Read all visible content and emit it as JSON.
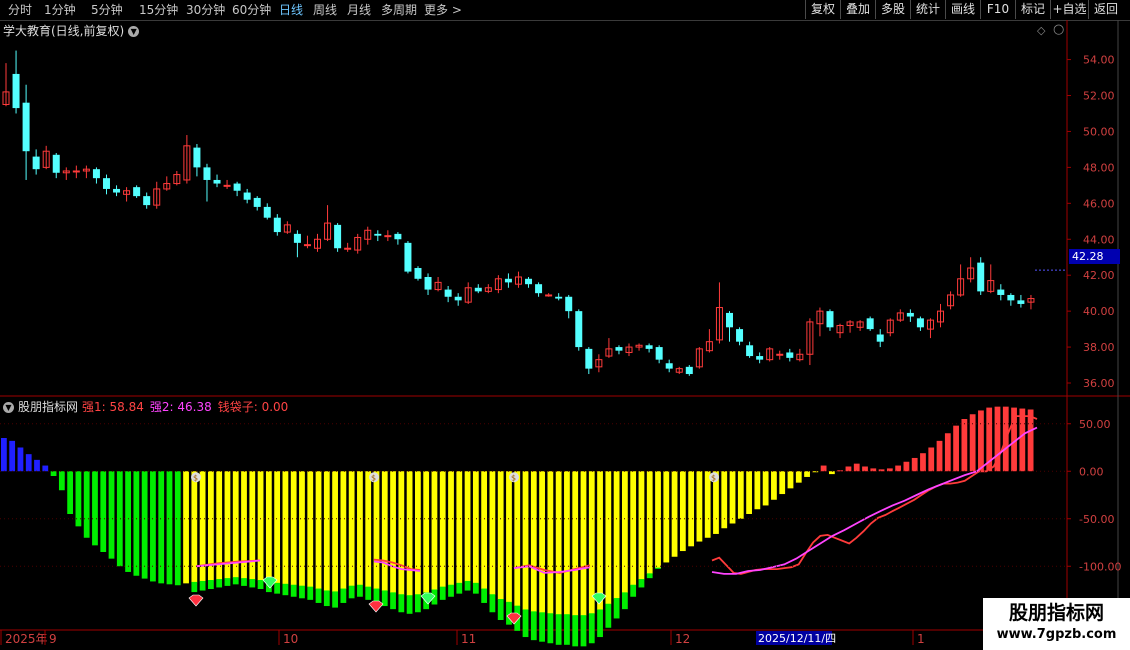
{
  "toolbar": {
    "periods": [
      "分时",
      "1分钟",
      "5分钟",
      "15分钟",
      "30分钟",
      "60分钟",
      "日线",
      "周线",
      "月线",
      "多周期",
      "更多 >"
    ],
    "right_buttons": [
      "复权",
      "叠加",
      "多股",
      "统计",
      "画线",
      "F10",
      "标记",
      "+自选",
      "返回"
    ]
  },
  "main": {
    "title": "学大教育(日线,前复权)",
    "price_label": "42.28",
    "y_ticks": [
      "54.00",
      "52.00",
      "50.00",
      "48.00",
      "46.00",
      "44.00",
      "42.00",
      "40.00",
      "38.00",
      "36.00"
    ]
  },
  "indicator": {
    "name": "股朋指标网",
    "s1": "强1: 58.84",
    "s2": "强2: 46.38",
    "s3": "钱袋子: 0.00",
    "y_ticks": [
      "50.00",
      "0.00",
      "-50.00",
      "-100.00"
    ]
  },
  "xaxis": {
    "labels": [
      "2025年",
      "9",
      "10",
      "11",
      "12",
      "1"
    ],
    "date_tag": "2025/12/11/四"
  },
  "watermark": {
    "line1": "股朋指标网",
    "line2": "www.7gpzb.com"
  },
  "colors": {
    "up": "#ff3b3b",
    "down": "#54ffff",
    "axis": "#a00000",
    "yellow": "#ffff00",
    "green": "#00ee00",
    "blue": "#2020ff",
    "magenta": "#ff44ff"
  },
  "chart_data": {
    "type": "candlestick",
    "ylim": [
      35.5,
      55.2
    ],
    "candles": [
      [
        51.5,
        52.2,
        53.8,
        51.4
      ],
      [
        53.2,
        51.3,
        54.5,
        51.0
      ],
      [
        51.6,
        48.9,
        52.6,
        47.3
      ],
      [
        48.6,
        47.9,
        49.0,
        47.6
      ],
      [
        48.0,
        48.9,
        49.2,
        47.9
      ],
      [
        48.7,
        47.7,
        48.8,
        47.4
      ],
      [
        47.7,
        47.8,
        48.0,
        47.3
      ],
      [
        47.8,
        47.8,
        48.1,
        47.4
      ],
      [
        47.8,
        47.9,
        48.1,
        47.4
      ],
      [
        47.9,
        47.4,
        48.0,
        47.1
      ],
      [
        47.4,
        46.8,
        47.6,
        46.5
      ],
      [
        46.8,
        46.6,
        47.0,
        46.4
      ],
      [
        46.5,
        46.7,
        46.9,
        46.1
      ],
      [
        46.9,
        46.4,
        47.0,
        46.3
      ],
      [
        46.4,
        45.9,
        46.6,
        45.7
      ],
      [
        45.9,
        46.8,
        47.2,
        45.7
      ],
      [
        46.8,
        47.1,
        47.5,
        46.7
      ],
      [
        47.1,
        47.6,
        47.8,
        47.0
      ],
      [
        47.3,
        49.2,
        49.8,
        47.1
      ],
      [
        49.1,
        48.0,
        49.3,
        47.5
      ],
      [
        48.0,
        47.3,
        48.2,
        46.1
      ],
      [
        47.3,
        47.1,
        47.6,
        46.9
      ],
      [
        47.0,
        47.0,
        47.3,
        46.8
      ],
      [
        47.1,
        46.7,
        47.2,
        46.4
      ],
      [
        46.6,
        46.2,
        46.8,
        46.0
      ],
      [
        46.3,
        45.8,
        46.4,
        45.6
      ],
      [
        45.8,
        45.2,
        46.0,
        45.1
      ],
      [
        45.2,
        44.4,
        45.4,
        44.2
      ],
      [
        44.4,
        44.8,
        45.0,
        44.3
      ],
      [
        44.3,
        43.8,
        44.5,
        43.0
      ],
      [
        43.7,
        43.7,
        44.2,
        43.5
      ],
      [
        43.5,
        44.0,
        44.3,
        43.3
      ],
      [
        44.0,
        44.9,
        45.9,
        43.9
      ],
      [
        44.8,
        43.5,
        44.9,
        43.3
      ],
      [
        43.5,
        43.5,
        43.8,
        43.3
      ],
      [
        43.4,
        44.1,
        44.3,
        43.2
      ],
      [
        44.0,
        44.5,
        44.7,
        43.7
      ],
      [
        44.3,
        44.2,
        44.5,
        43.9
      ],
      [
        44.2,
        44.2,
        44.5,
        43.9
      ],
      [
        44.3,
        44.0,
        44.4,
        43.7
      ],
      [
        43.8,
        42.2,
        43.9,
        42.1
      ],
      [
        42.4,
        41.8,
        42.5,
        41.7
      ],
      [
        41.9,
        41.2,
        42.1,
        40.9
      ],
      [
        41.2,
        41.6,
        41.9,
        41.1
      ],
      [
        41.2,
        40.8,
        41.4,
        40.5
      ],
      [
        40.8,
        40.6,
        41.0,
        40.3
      ],
      [
        40.5,
        41.3,
        41.6,
        40.4
      ],
      [
        41.3,
        41.1,
        41.5,
        41.0
      ],
      [
        41.1,
        41.3,
        41.5,
        41.0
      ],
      [
        41.2,
        41.8,
        42.0,
        41.0
      ],
      [
        41.8,
        41.6,
        42.1,
        41.3
      ],
      [
        41.5,
        41.9,
        42.2,
        41.3
      ],
      [
        41.8,
        41.5,
        41.9,
        41.3
      ],
      [
        41.5,
        41.0,
        41.6,
        40.8
      ],
      [
        40.9,
        40.9,
        41.0,
        40.8
      ],
      [
        40.8,
        40.7,
        41.0,
        40.6
      ],
      [
        40.8,
        40.0,
        40.9,
        39.6
      ],
      [
        40.0,
        38.0,
        40.1,
        37.8
      ],
      [
        37.9,
        36.8,
        38.0,
        36.5
      ],
      [
        36.9,
        37.3,
        37.6,
        36.6
      ],
      [
        37.5,
        37.9,
        38.5,
        37.4
      ],
      [
        38.0,
        37.8,
        38.1,
        37.6
      ],
      [
        37.7,
        38.0,
        38.2,
        37.5
      ],
      [
        38.0,
        38.1,
        38.2,
        37.8
      ],
      [
        38.1,
        37.9,
        38.2,
        37.7
      ],
      [
        38.0,
        37.3,
        38.1,
        37.1
      ],
      [
        37.1,
        36.8,
        37.3,
        36.6
      ],
      [
        36.6,
        36.8,
        36.9,
        36.5
      ],
      [
        36.9,
        36.5,
        37.0,
        36.4
      ],
      [
        36.9,
        37.9,
        38.0,
        36.8
      ],
      [
        37.8,
        38.3,
        39.0,
        37.7
      ],
      [
        38.4,
        40.2,
        41.6,
        38.2
      ],
      [
        39.9,
        39.1,
        40.0,
        38.3
      ],
      [
        39.0,
        38.3,
        39.1,
        38.1
      ],
      [
        38.1,
        37.5,
        38.3,
        37.4
      ],
      [
        37.5,
        37.3,
        37.7,
        37.1
      ],
      [
        37.3,
        37.9,
        38.0,
        37.2
      ],
      [
        37.6,
        37.6,
        37.8,
        37.3
      ],
      [
        37.7,
        37.4,
        37.9,
        37.2
      ],
      [
        37.3,
        37.6,
        37.9,
        37.2
      ],
      [
        37.6,
        39.4,
        39.6,
        37.0
      ],
      [
        39.3,
        40.0,
        40.2,
        38.6
      ],
      [
        40.0,
        39.1,
        40.1,
        38.9
      ],
      [
        38.8,
        39.2,
        39.3,
        38.5
      ],
      [
        39.2,
        39.4,
        39.5,
        38.8
      ],
      [
        39.1,
        39.4,
        39.5,
        38.9
      ],
      [
        39.6,
        39.0,
        39.7,
        38.9
      ],
      [
        38.7,
        38.3,
        39.0,
        38.0
      ],
      [
        38.8,
        39.5,
        39.6,
        38.6
      ],
      [
        39.5,
        39.9,
        40.1,
        39.4
      ],
      [
        39.9,
        39.7,
        40.1,
        39.4
      ],
      [
        39.6,
        39.1,
        39.7,
        38.9
      ],
      [
        39.0,
        39.5,
        39.6,
        38.5
      ],
      [
        39.4,
        40.0,
        40.4,
        39.1
      ],
      [
        40.3,
        40.9,
        41.1,
        40.1
      ],
      [
        40.9,
        41.8,
        42.6,
        40.8
      ],
      [
        41.8,
        42.4,
        43.0,
        41.6
      ],
      [
        42.7,
        41.1,
        43.0,
        40.9
      ],
      [
        41.1,
        41.7,
        42.6,
        41.0
      ],
      [
        41.2,
        40.9,
        41.5,
        40.6
      ],
      [
        40.9,
        40.6,
        41.0,
        40.3
      ],
      [
        40.6,
        40.4,
        40.9,
        40.2
      ],
      [
        40.5,
        40.7,
        40.9,
        40.1
      ]
    ],
    "indicator": {
      "ylim": [
        -165,
        75
      ],
      "bars": [
        35,
        32,
        25,
        18,
        12,
        6,
        -5,
        -20,
        -45,
        -58,
        -70,
        -78,
        -85,
        -92,
        -100,
        -106,
        -110,
        -113,
        -116,
        -118,
        -119,
        -120,
        -118,
        -117,
        -116,
        -115,
        -114,
        -113,
        -112,
        -113,
        -114,
        -115,
        -117,
        -118,
        -119,
        -120,
        -121,
        -122,
        -124,
        -126,
        -127,
        -124,
        -121,
        -120,
        -122,
        -124,
        -126,
        -128,
        -130,
        -131,
        -130,
        -128,
        -125,
        -122,
        -120,
        -118,
        -116,
        -118,
        -124,
        -130,
        -135,
        -138,
        -142,
        -146,
        -148,
        -149,
        -150,
        -151,
        -151,
        -152,
        -152,
        -150,
        -146,
        -140,
        -134,
        -128,
        -120,
        -114,
        -108,
        -102,
        -96,
        -90,
        -84,
        -79,
        -74,
        -70,
        -66,
        -60,
        -55,
        -50,
        -45,
        -40,
        -36,
        -30,
        -24,
        -18,
        -12,
        -6,
        0,
        6,
        -3,
        1,
        5,
        8,
        5,
        3,
        2,
        3,
        6,
        10,
        14,
        19,
        25,
        32,
        40,
        48,
        55,
        60,
        64,
        67,
        68,
        68,
        67,
        66,
        65
      ],
      "qiang1": [
        -100,
        -97,
        -95,
        -94,
        -93,
        -94,
        -96,
        -99,
        -103,
        -104,
        -102,
        -99,
        -104,
        -107,
        -103,
        -99,
        -94,
        -91,
        -99,
        -107,
        -108,
        -106,
        -104,
        -103,
        -103,
        -103,
        -102,
        -101,
        -98,
        -86,
        -75,
        -68,
        -67,
        -70,
        -73,
        -76,
        -70,
        -63,
        -55,
        -49,
        -46,
        -42,
        -38,
        -34,
        -30,
        -25,
        -20,
        -16,
        -13,
        -13,
        -12,
        -10,
        -5,
        0,
        0,
        5,
        20,
        40,
        58,
        58,
        58,
        55
      ],
      "qiang2": [
        -100,
        -98,
        -96,
        -94,
        -95,
        -96,
        -100,
        -103,
        -104,
        -105,
        -102,
        -100,
        -107,
        -106,
        -104,
        -101,
        -100,
        -98,
        -106,
        -108,
        -108,
        -105,
        -104,
        -101,
        -98,
        -92,
        -84,
        -76,
        -68,
        -62,
        -55,
        -48,
        -42,
        -36,
        -31,
        -25,
        -19,
        -14,
        -9,
        -4,
        0,
        10,
        20,
        30,
        40,
        46
      ]
    }
  }
}
